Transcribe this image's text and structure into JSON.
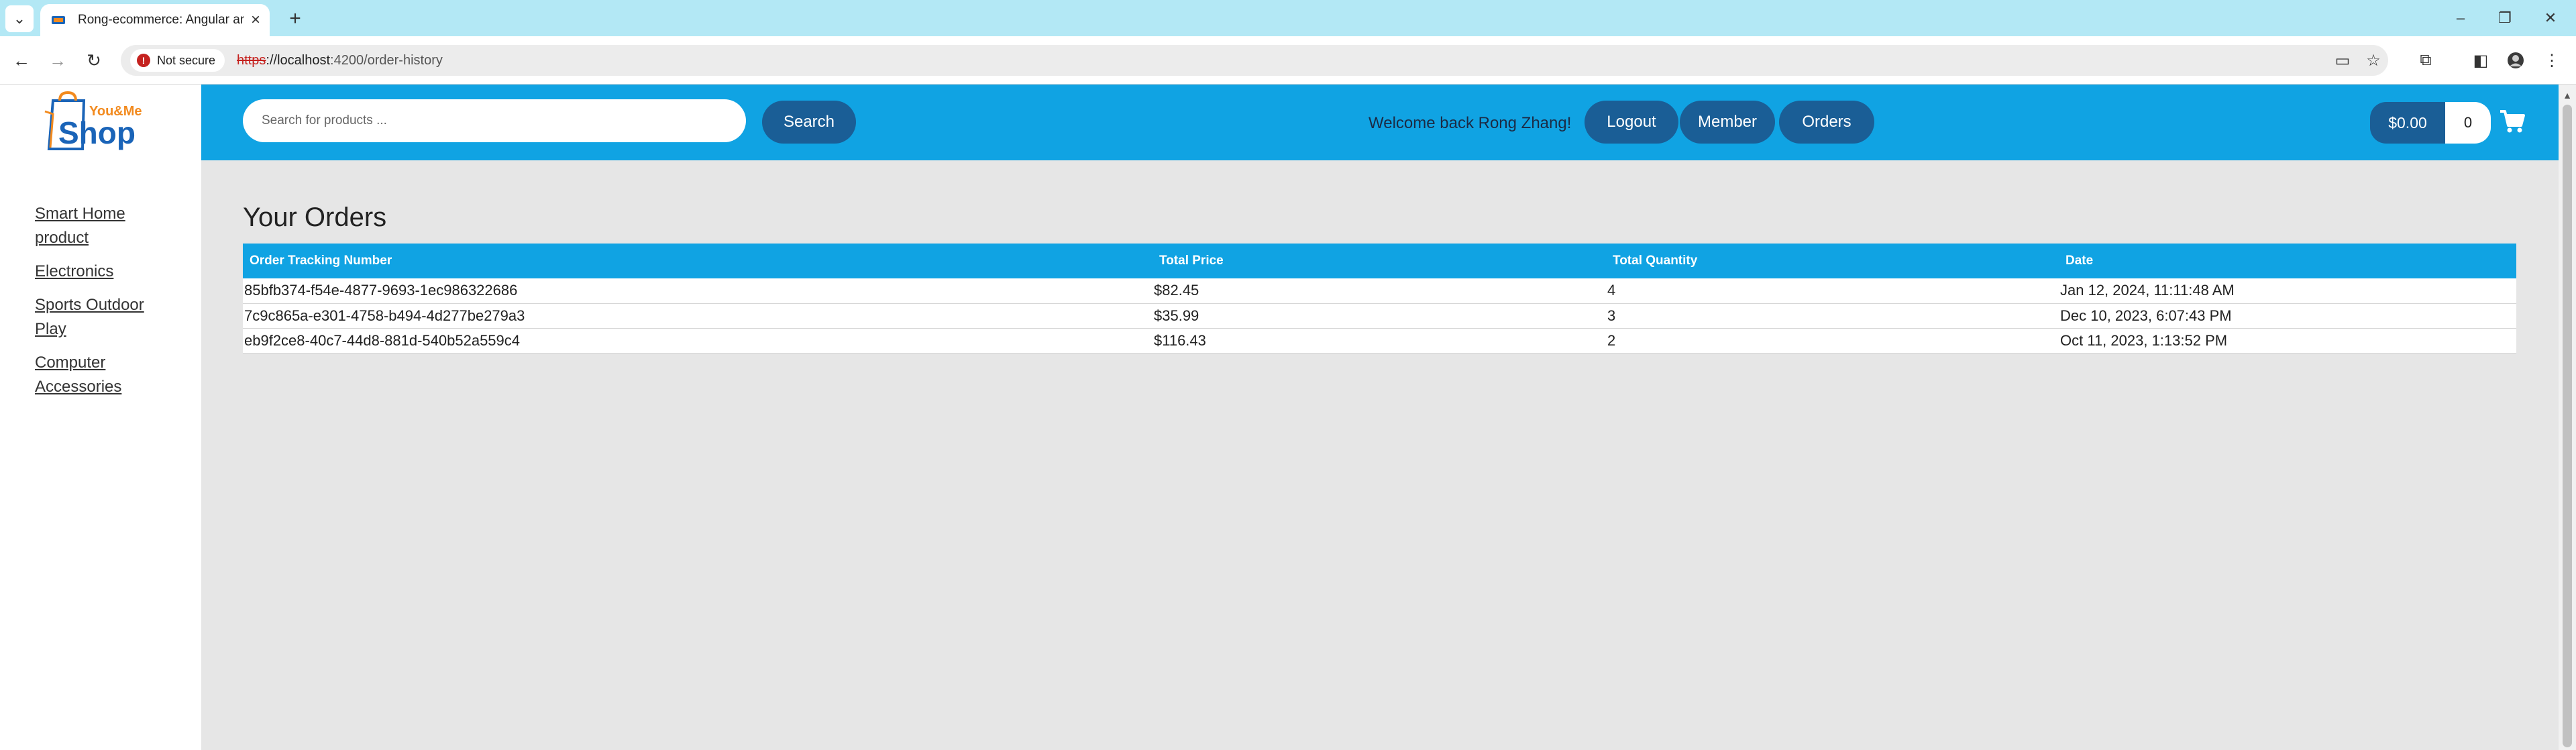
{
  "browser": {
    "tab_title": "Rong-ecommerce: Angular and",
    "new_tab_glyph": "+",
    "security_label": "Not secure",
    "url_scheme": "https",
    "url_host": "://localhost",
    "url_rest": ":4200/order-history"
  },
  "header": {
    "logo_text_top": "You&Me",
    "logo_text_main": "Shop",
    "search_placeholder": "Search for products ...",
    "search_button": "Search",
    "welcome_text": "Welcome back Rong Zhang!",
    "logout_button": "Logout",
    "member_button": "Member",
    "orders_button": "Orders",
    "cart_total": "$0.00",
    "cart_quantity": "0"
  },
  "sidebar": {
    "items": [
      {
        "label": "Smart Home product"
      },
      {
        "label": "Electronics"
      },
      {
        "label": "Sports Outdoor Play"
      },
      {
        "label": "Computer Accessories"
      }
    ]
  },
  "main": {
    "title": "Your Orders",
    "columns": [
      "Order Tracking Number",
      "Total Price",
      "Total Quantity",
      "Date"
    ],
    "rows": [
      [
        "85bfb374-f54e-4877-9693-1ec986322686",
        "$82.45",
        "4",
        "Jan 12, 2024, 11:11:48 AM"
      ],
      [
        "7c9c865a-e301-4758-b494-4d277be279a3",
        "$35.99",
        "3",
        "Dec 10, 2023, 6:07:43 PM"
      ],
      [
        "eb9f2ce8-40c7-44d8-881d-540b52a559c4",
        "$116.43",
        "2",
        "Oct 11, 2023, 1:13:52 PM"
      ]
    ]
  },
  "colors": {
    "header_blue": "#10a3e3",
    "button_navy": "#1a5e96",
    "tabbar": "#b3e8f5",
    "page_bg": "#e6e6e6",
    "logo_blue": "#1a64b8",
    "logo_orange": "#f28a1e"
  },
  "icons": {
    "tab_menu": "chevron-down-icon",
    "back": "arrow-left-icon",
    "forward": "arrow-right-icon",
    "reload": "reload-icon",
    "cart": "shopping-cart-icon"
  }
}
